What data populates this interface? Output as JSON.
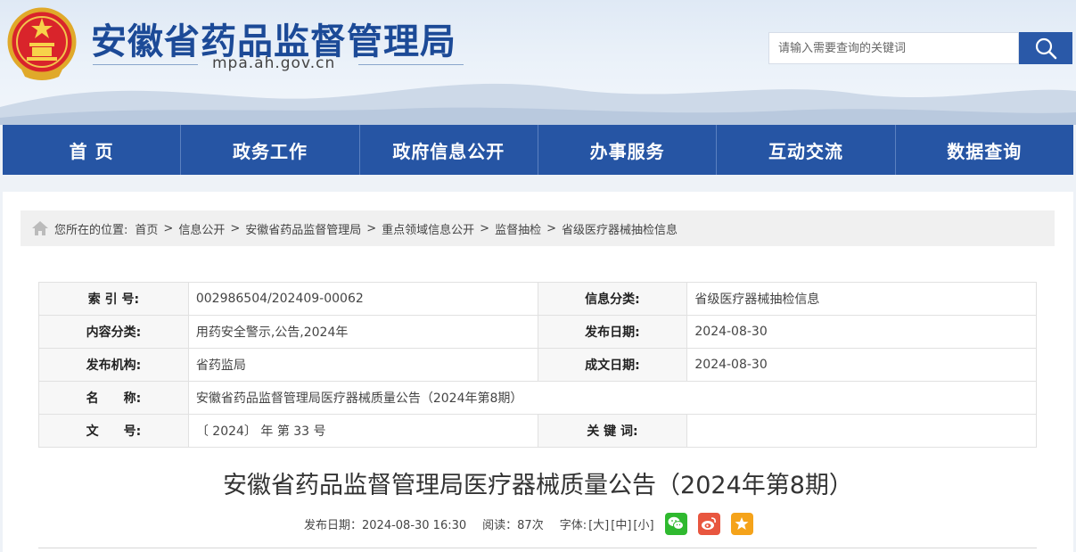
{
  "header": {
    "site_title": "安徽省药品监督管理局",
    "site_domain": "mpa.ah.gov.cn",
    "emblem_icon": "national-emblem-icon"
  },
  "search": {
    "placeholder": "请输入需要查询的关键词",
    "button_icon": "search-icon"
  },
  "nav": {
    "items": [
      "首 页",
      "政务工作",
      "政府信息公开",
      "办事服务",
      "互动交流",
      "数据查询"
    ]
  },
  "breadcrumb": {
    "prefix": "您所在的位置:",
    "items": [
      "首页",
      "信息公开",
      "安徽省药品监督管理局",
      "重点领域信息公开",
      "监督抽检",
      "省级医疗器械抽检信息"
    ],
    "separator": ">"
  },
  "meta": {
    "index_label": "索 引 号:",
    "index_value": "002986504/202409-00062",
    "info_cat_label": "信息分类:",
    "info_cat_value": "省级医疗器械抽检信息",
    "content_cat_label": "内容分类:",
    "content_cat_value": "用药安全警示,公告,2024年",
    "pub_date_label": "发布日期:",
    "pub_date_value": "2024-08-30",
    "org_label": "发布机构:",
    "org_value": "省药监局",
    "made_date_label": "成文日期:",
    "made_date_value": "2024-08-30",
    "name_label": "名　　称:",
    "name_value": "安徽省药品监督管理局医疗器械质量公告（2024年第8期）",
    "doc_no_label": "文　　号:",
    "doc_no_value": "〔 2024〕 年 第 33 号",
    "keyword_label": "关 键 词:",
    "keyword_value": ""
  },
  "article": {
    "title": "安徽省药品监督管理局医疗器械质量公告（2024年第8期）",
    "date_text": "发布日期：2024-08-30 16:30",
    "views_text": "阅读：87次",
    "font_label": "字体:",
    "font_large": "[大]",
    "font_medium": "[中]",
    "font_small": "[小]"
  },
  "colors": {
    "brand": "#2655a4",
    "title": "#1c4a97",
    "wechat": "#2fb92f",
    "weibo": "#e8563f",
    "favorite": "#f5a31a"
  }
}
